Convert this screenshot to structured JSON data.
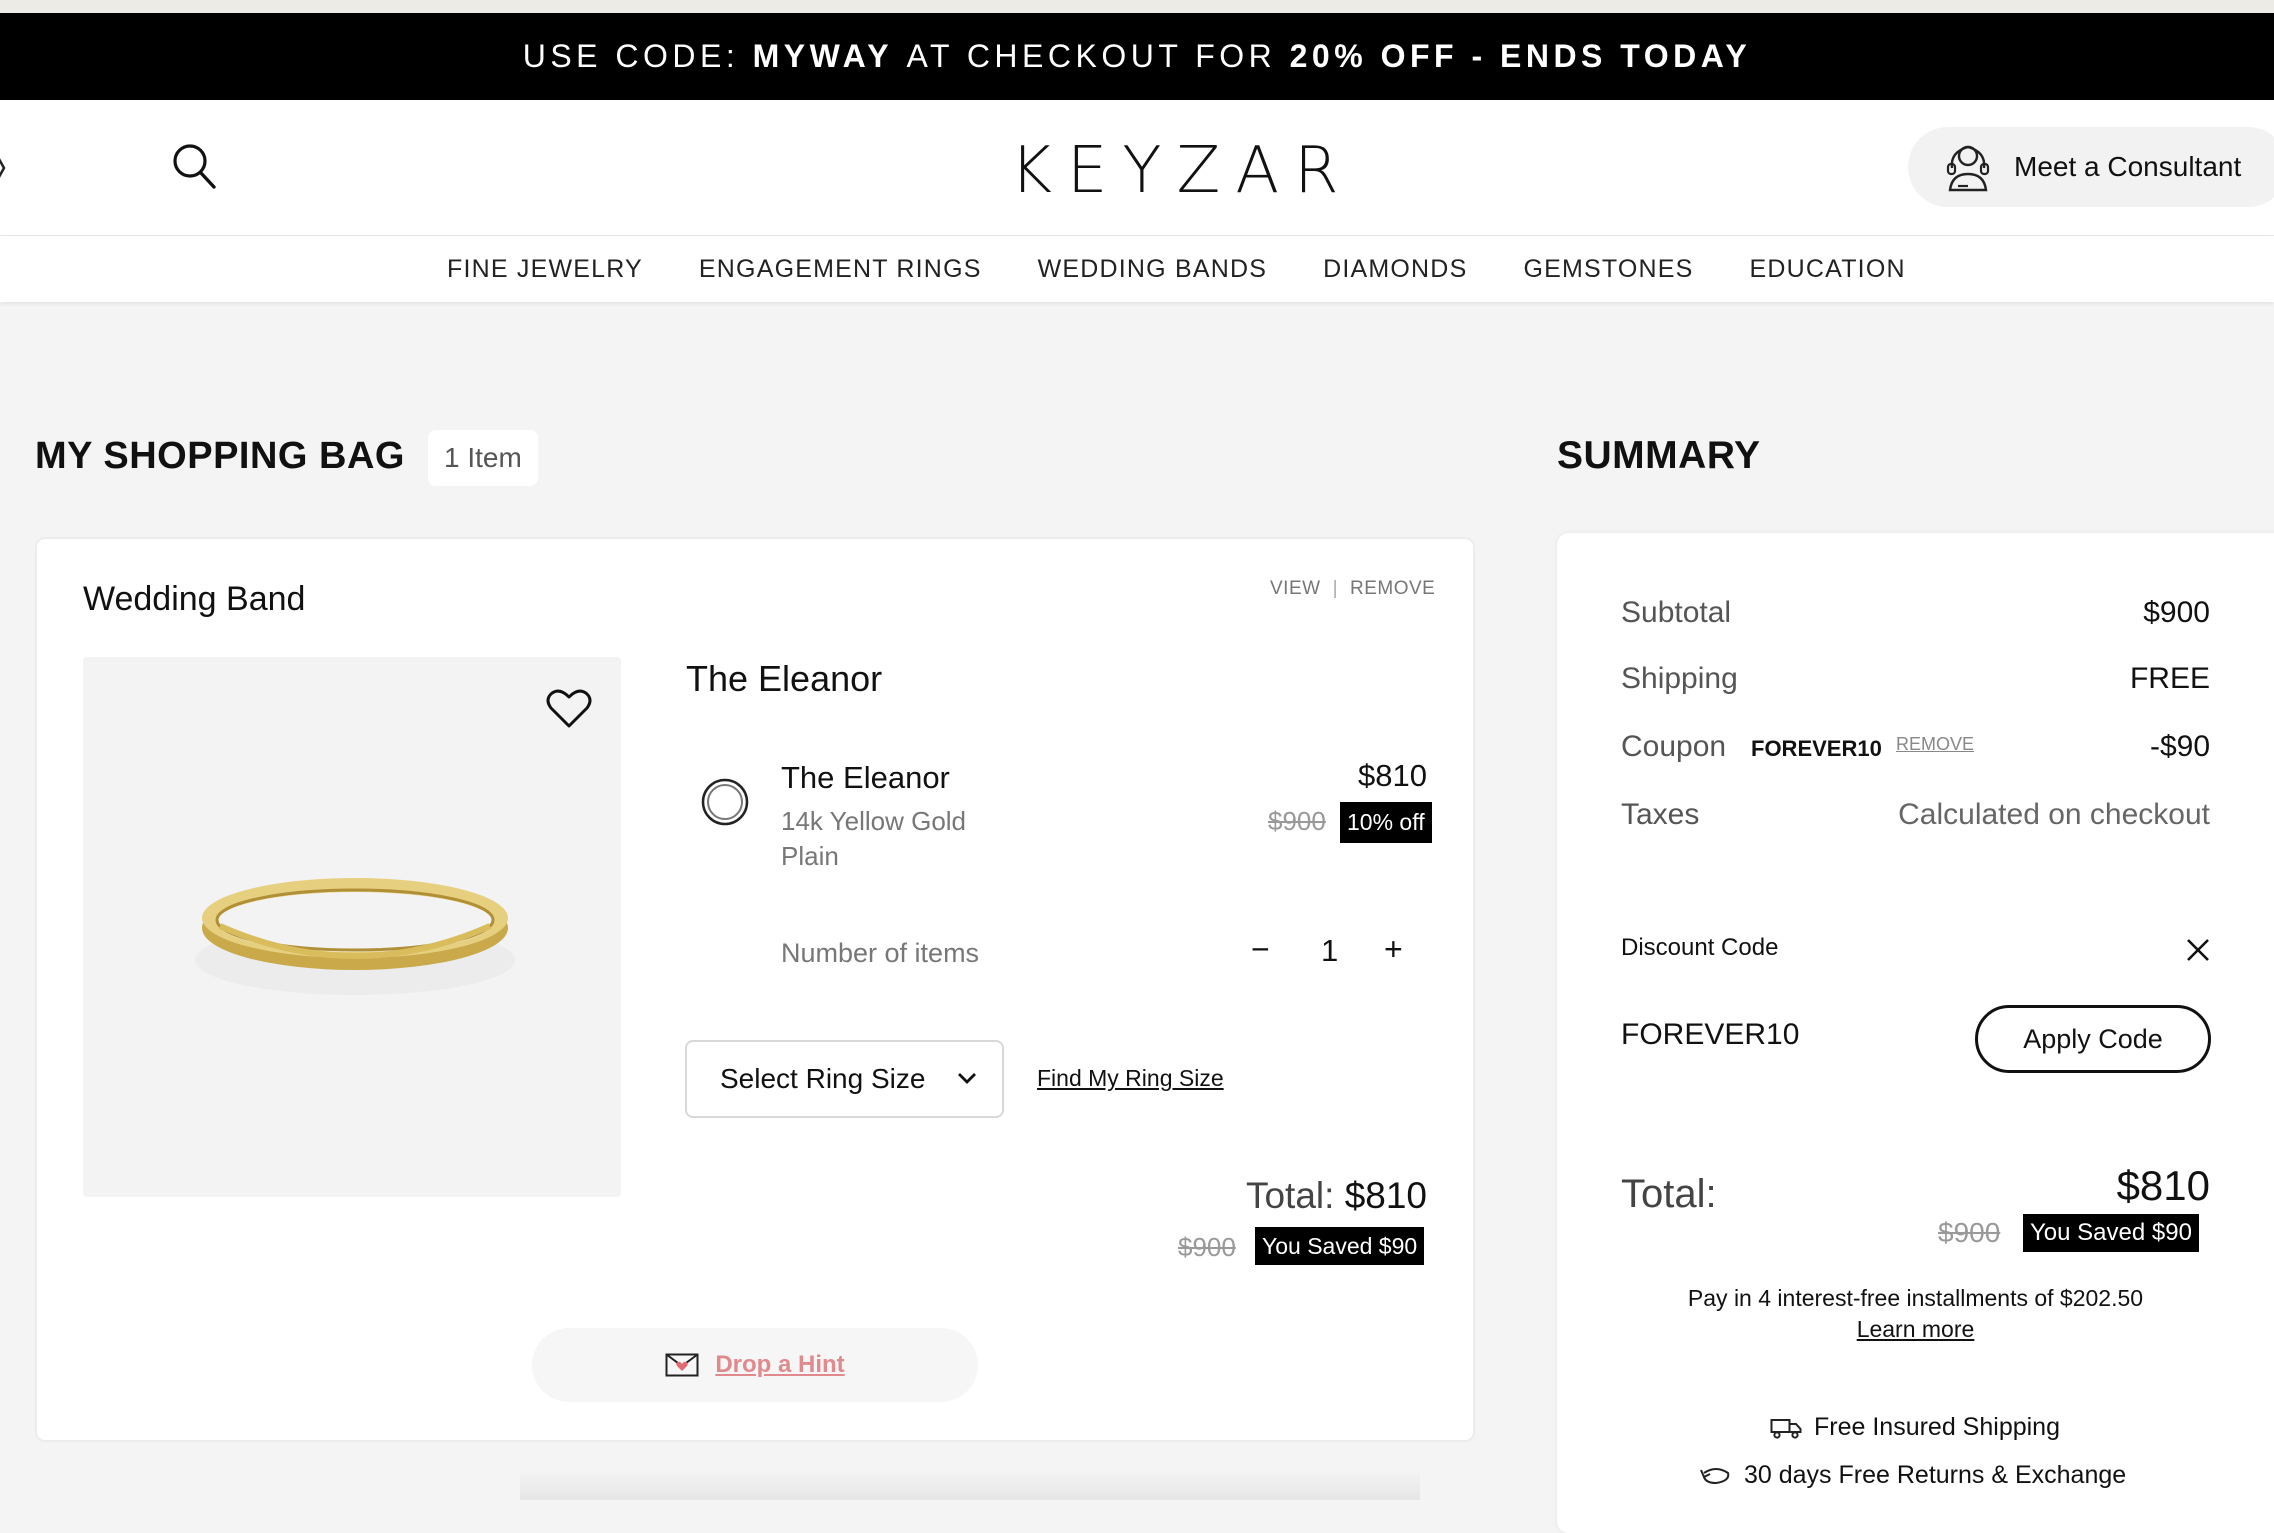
{
  "promo": {
    "part1": "USE CODE: ",
    "code": "MYWAY",
    "part2": " AT CHECKOUT FOR ",
    "discount": "20% OFF - ENDS TODAY"
  },
  "header": {
    "logo": "KEYZAR",
    "consultant_label": "Meet a Consultant"
  },
  "nav": {
    "items": [
      "FINE JEWELRY",
      "ENGAGEMENT RINGS",
      "WEDDING BANDS",
      "DIAMONDS",
      "GEMSTONES",
      "EDUCATION"
    ]
  },
  "bag": {
    "title": "MY SHOPPING BAG",
    "count_label": "1 Item",
    "item": {
      "category": "Wedding Band",
      "view_label": "VIEW",
      "remove_label": "REMOVE",
      "name": "The Eleanor",
      "variant_name": "The Eleanor",
      "metal": "14k Yellow Gold",
      "style": "Plain",
      "price": "$810",
      "original_price": "$900",
      "discount_badge": "10% off",
      "qty_label": "Number of items",
      "qty_minus": "−",
      "qty_value": "1",
      "qty_plus": "+",
      "ring_size_label": "Select Ring Size",
      "find_size_link": "Find My Ring Size",
      "total_label": "Total:",
      "total_value": "$810",
      "total_original": "$900",
      "saved_badge": "You Saved $90",
      "hint_label": "Drop a Hint"
    }
  },
  "summary": {
    "title": "SUMMARY",
    "subtotal_label": "Subtotal",
    "subtotal_value": "$900",
    "shipping_label": "Shipping",
    "shipping_value": "FREE",
    "coupon_label": "Coupon",
    "coupon_code": "FOREVER10",
    "coupon_remove": "REMOVE",
    "coupon_value": "-$90",
    "taxes_label": "Taxes",
    "taxes_value": "Calculated on checkout",
    "discount_label": "Discount Code",
    "discount_input_value": "FOREVER10",
    "apply_label": "Apply Code",
    "total_label": "Total:",
    "total_value": "$810",
    "total_original": "$900",
    "saved_badge": "You Saved $90",
    "installments_text": "Pay in 4 interest-free installments of $202.50",
    "learn_more": "Learn more",
    "shipping_perk": "Free Insured Shipping",
    "returns_perk": "30 days Free Returns & Exchange"
  },
  "icons": {
    "search": "search-icon",
    "consultant": "consultant-icon",
    "heart": "heart-icon",
    "chevron": "chevron-down-icon",
    "close": "close-icon",
    "hint": "envelope-heart-icon",
    "truck": "truck-icon",
    "returns": "return-icon"
  },
  "colors": {
    "promo_bg": "#000000",
    "page_bg": "#f4f4f4",
    "hint_link": "#e08a8e",
    "badge_bg": "#000000"
  }
}
